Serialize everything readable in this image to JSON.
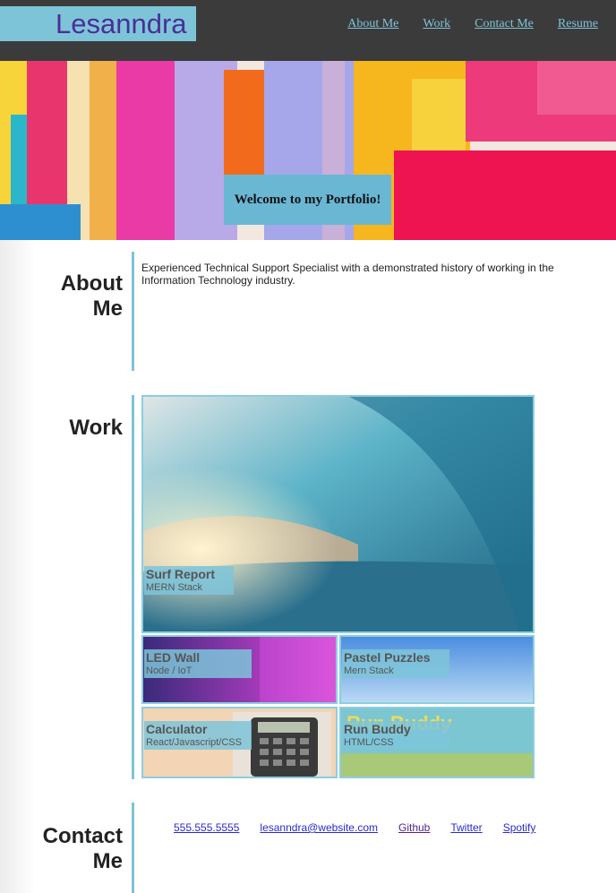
{
  "header": {
    "brand": "Lesanndra",
    "nav": [
      "About Me",
      "Work",
      "Contact Me",
      "Resume"
    ]
  },
  "hero": {
    "welcome": "Welcome to my Portfolio!"
  },
  "about": {
    "title": "About Me",
    "text": "Experienced Technical Support Specialist with a demonstrated history of working in the Information Technology industry."
  },
  "work": {
    "title": "Work",
    "projects": [
      {
        "title": "Surf Report",
        "stack": "MERN Stack"
      },
      {
        "title": "LED Wall",
        "stack": "Node / IoT"
      },
      {
        "title": "Pastel Puzzles",
        "stack": "Mern Stack"
      },
      {
        "title": "Calculator",
        "stack": "React/Javascript/CSS"
      },
      {
        "title": "Run Buddy",
        "stack": "HTML/CSS",
        "image_text": "Run Buddy"
      }
    ]
  },
  "contact": {
    "title": "Contact Me",
    "links": [
      "555.555.5555",
      "lesanndra@website.com",
      "Github",
      "Twitter",
      "Spotify"
    ]
  },
  "colors": {
    "accent": "#7ec4d9",
    "header_bg": "#3b3b3b",
    "brand_text": "#4a2f96"
  }
}
